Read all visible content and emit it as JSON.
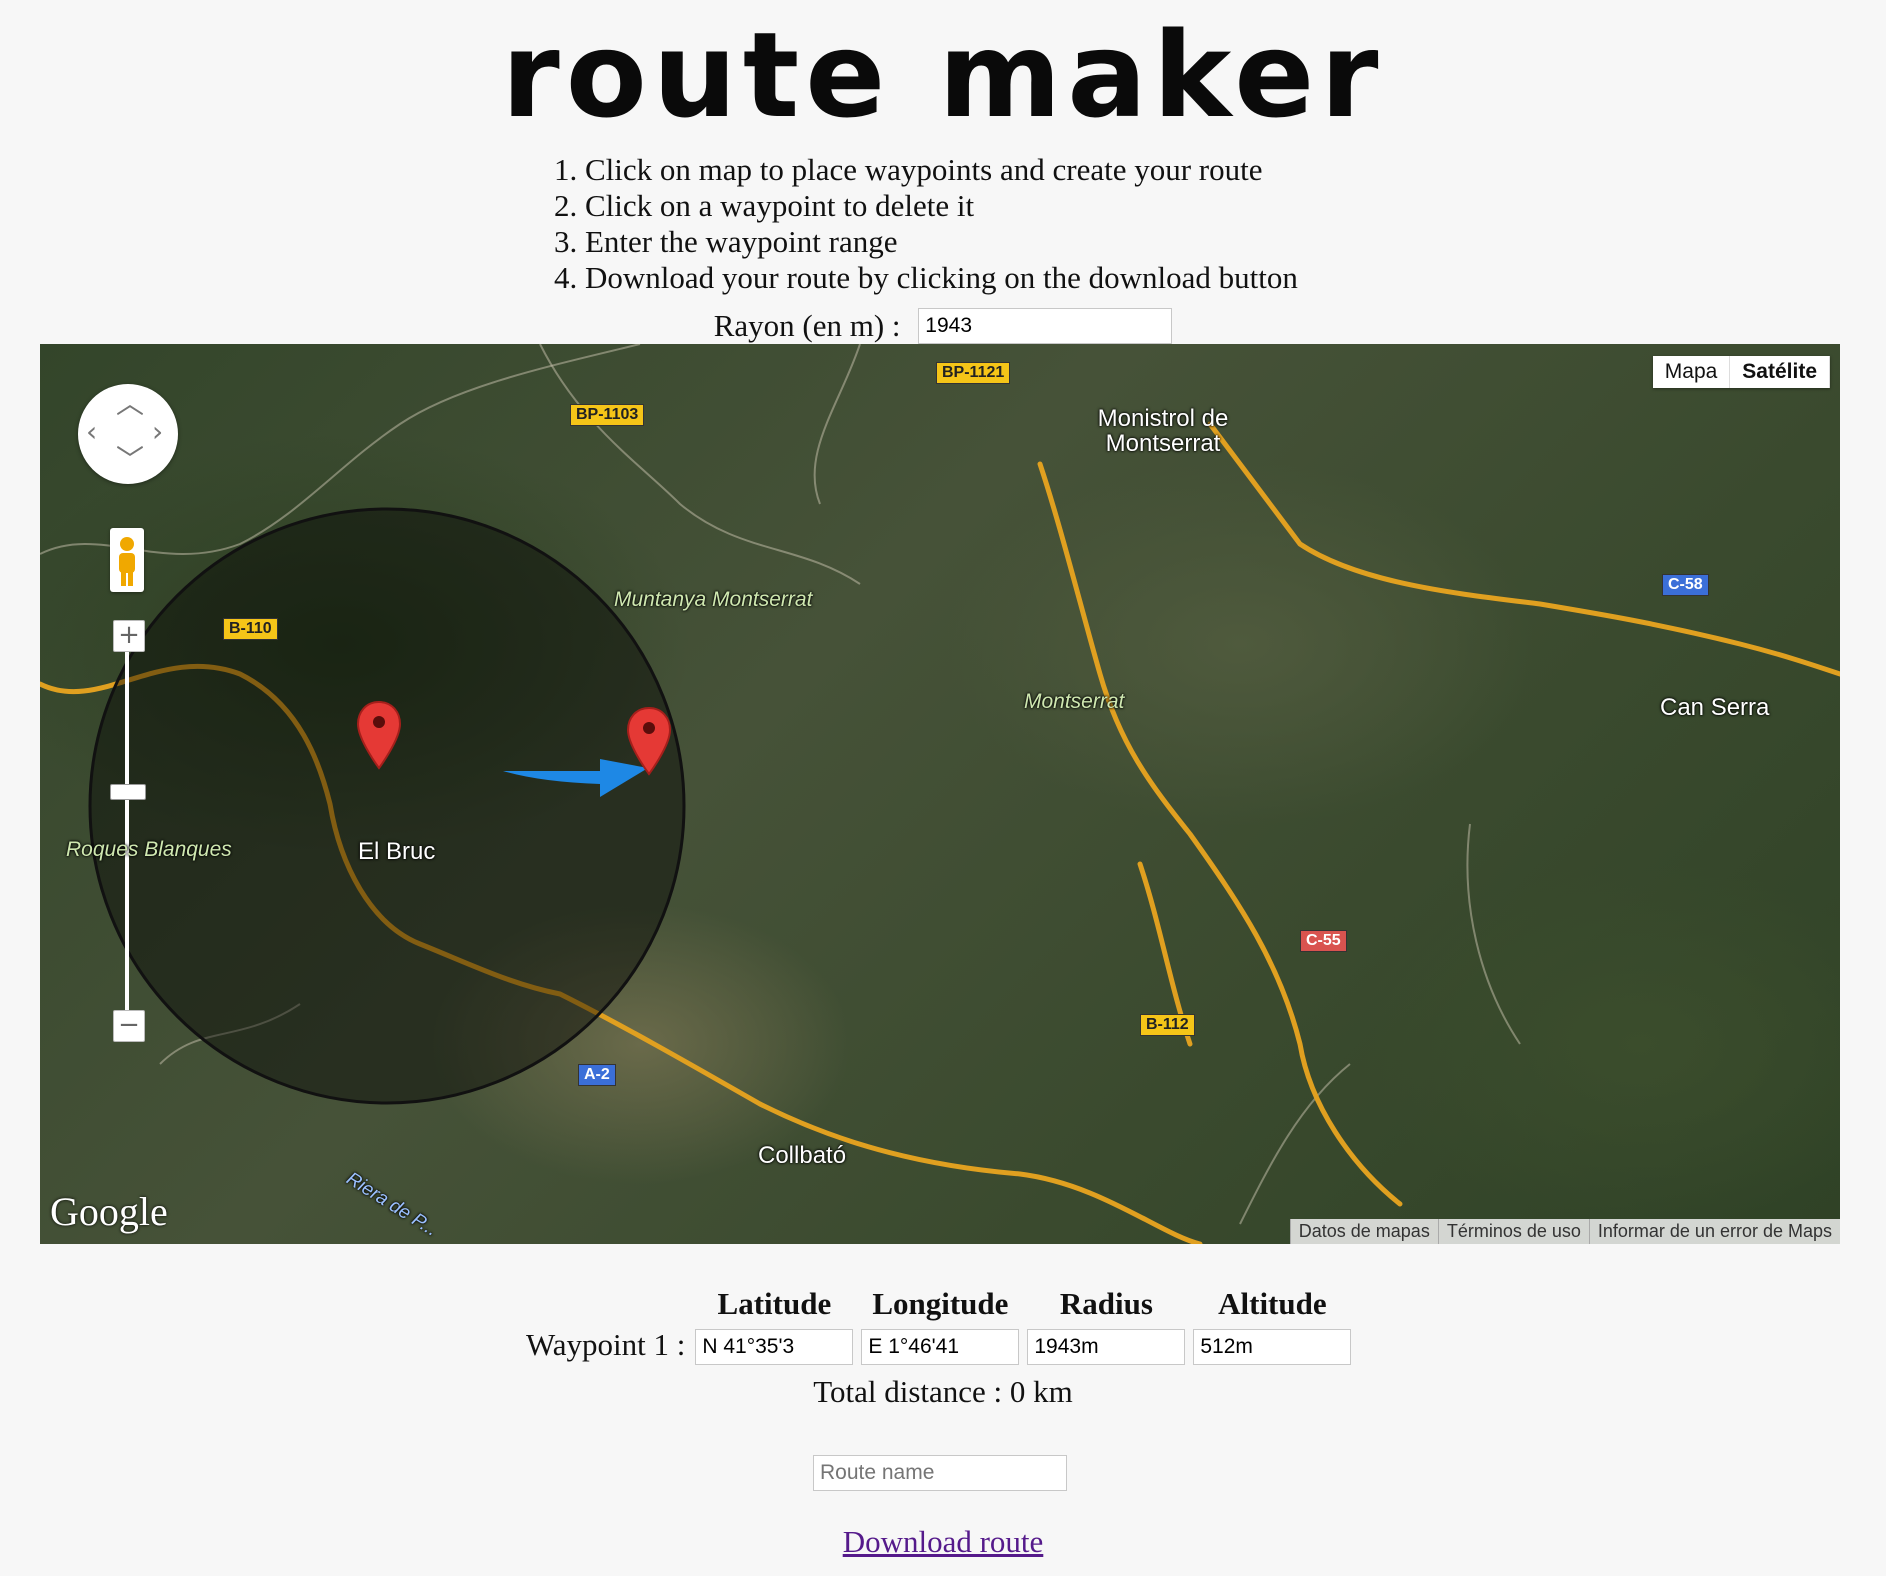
{
  "app": {
    "logo": "route maker"
  },
  "instructions": [
    "1. Click on map to place waypoints and create your route",
    "2. Click on a waypoint to delete it",
    "3. Enter the waypoint range",
    "4. Download your route by clicking on the download button"
  ],
  "radius": {
    "label": "Rayon (en m) :",
    "value": "1943"
  },
  "map": {
    "type_buttons": {
      "map": "Mapa",
      "satellite": "Satélite"
    },
    "active_type": "Satélite",
    "labels": {
      "monistrol": "Monistrol de Montserrat",
      "muntanya": "Muntanya Montserrat",
      "montserrat": "Montserrat",
      "can_serra": "Can Serra",
      "roques": "Roques Blanques",
      "el_bruc": "El Bruc",
      "collbato": "Collbató",
      "riera": "Riera de P..."
    },
    "roads": {
      "bp1121": "BP-1121",
      "bp1103": "BP-1103",
      "b110": "B-110",
      "c58": "C-58",
      "c55": "C-55",
      "b112": "B-112",
      "a2": "A-2"
    },
    "logo": "Google",
    "attribution": [
      "Datos de mapas",
      "Términos de uso",
      "Informar de un error de Maps"
    ],
    "colors": {
      "marker": "#e53935",
      "arrow": "#1e88e5",
      "road": "#e0a020"
    }
  },
  "waypoints": {
    "headers": [
      "Latitude",
      "Longitude",
      "Radius",
      "Altitude"
    ],
    "rows": [
      {
        "label": "Waypoint 1 :",
        "latitude": "N 41°35'3",
        "longitude": "E 1°46'41",
        "radius": "1943m",
        "altitude": "512m"
      }
    ]
  },
  "total_distance": "Total distance : 0 km",
  "route_name": {
    "placeholder": "Route name"
  },
  "download_label": "Download route"
}
